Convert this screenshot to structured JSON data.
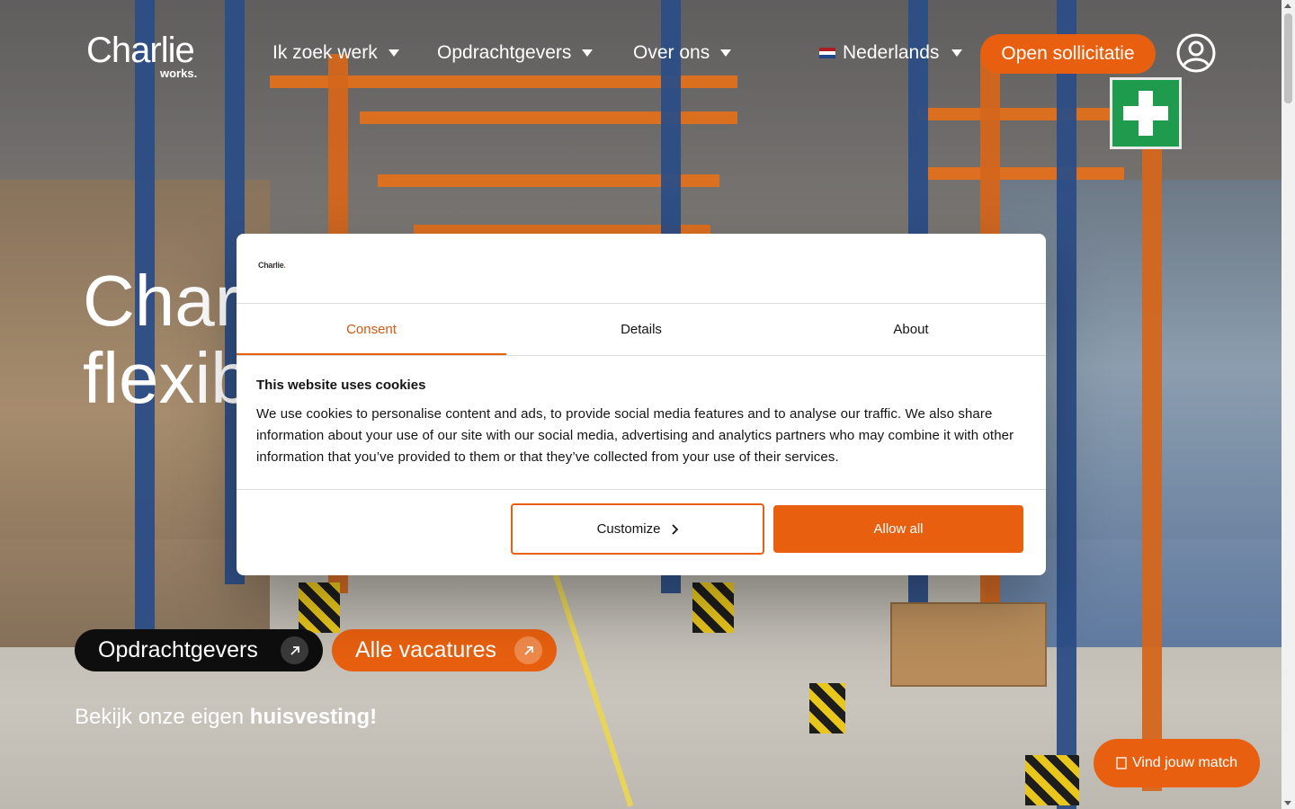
{
  "brand": {
    "name": "Charlie",
    "sub": "works.",
    "accent": "#e8600f"
  },
  "nav": {
    "items": [
      {
        "label": "Ik zoek werk"
      },
      {
        "label": "Opdrachtgevers"
      },
      {
        "label": "Over ons"
      }
    ],
    "language": "Nederlands",
    "cta": "Open sollicitatie",
    "account_icon": "user-circle-icon"
  },
  "hero": {
    "title": "Charlie Works\nflexible",
    "buttons": [
      {
        "label": "Opdrachtgevers",
        "icon": "arrow-up-right-icon"
      },
      {
        "label": "Alle vacatures",
        "icon": "arrow-up-right-icon"
      }
    ],
    "sub_prefix": "Bekijk onze eigen ",
    "sub_bold": "huisvesting!",
    "match_button": "Vind jouw match",
    "match_icon": "document-icon"
  },
  "cookie_dialog": {
    "logo": "Charlie",
    "tabs": [
      {
        "label": "Consent",
        "active": true
      },
      {
        "label": "Details",
        "active": false
      },
      {
        "label": "About",
        "active": false
      }
    ],
    "heading": "This website uses cookies",
    "body": "We use cookies to personalise content and ads, to provide social media features and to analyse our traffic. We also share information about your use of our site with our social media, advertising and analytics partners who may combine it with other information that you’ve provided to them or that they’ve collected from your use of their services.",
    "customize_label": "Customize",
    "allow_all_label": "Allow all"
  }
}
